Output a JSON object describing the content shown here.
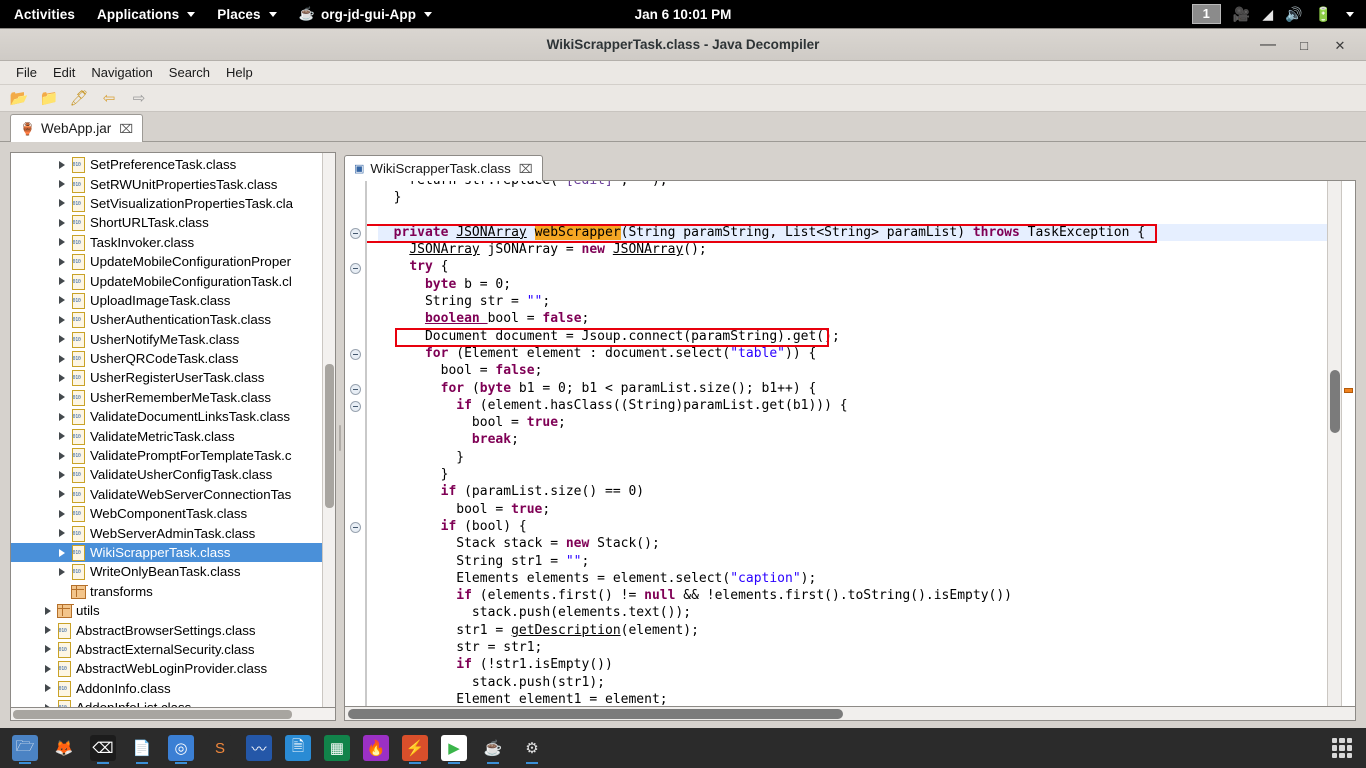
{
  "gnome_topbar": {
    "activities": "Activities",
    "applications": "Applications",
    "places": "Places",
    "app_menu": "org-jd-gui-App",
    "clock": "Jan 6  10:01 PM",
    "workspace": "1",
    "tray_icons": [
      "screencast-icon",
      "wifi-icon",
      "volume-icon",
      "battery-icon",
      "chevron-down-icon"
    ]
  },
  "window": {
    "title": "WikiScrapperTask.class - Java Decompiler",
    "minimize": "—",
    "maximize": "□",
    "close": "✕"
  },
  "menubar": {
    "items": [
      {
        "label": "File"
      },
      {
        "label": "Edit"
      },
      {
        "label": "Navigation"
      },
      {
        "label": "Search"
      },
      {
        "label": "Help"
      }
    ]
  },
  "toolbar": {
    "buttons": [
      {
        "name": "open-file-icon",
        "glyph": "📂"
      },
      {
        "name": "open-type-icon",
        "glyph": "📁"
      },
      {
        "name": "open-type-hierarchy-icon",
        "glyph": "🖊"
      },
      {
        "name": "back-arrow-icon",
        "glyph": "⇦"
      },
      {
        "name": "forward-arrow-icon",
        "glyph": "⇨"
      }
    ]
  },
  "jar_tab": {
    "label": "WebApp.jar",
    "close": "⌧"
  },
  "editor_tab": {
    "label": "WikiScrapperTask.class",
    "close": "⌧"
  },
  "tree": {
    "items": [
      {
        "label": "SetPreferenceTask.class",
        "type": "class",
        "indent": 3,
        "arrow": true,
        "selected": false
      },
      {
        "label": "SetRWUnitPropertiesTask.class",
        "type": "class",
        "indent": 3,
        "arrow": true,
        "selected": false
      },
      {
        "label": "SetVisualizationPropertiesTask.cla",
        "type": "class",
        "indent": 3,
        "arrow": true,
        "selected": false
      },
      {
        "label": "ShortURLTask.class",
        "type": "class",
        "indent": 3,
        "arrow": true,
        "selected": false
      },
      {
        "label": "TaskInvoker.class",
        "type": "class",
        "indent": 3,
        "arrow": true,
        "selected": false
      },
      {
        "label": "UpdateMobileConfigurationProper",
        "type": "class",
        "indent": 3,
        "arrow": true,
        "selected": false
      },
      {
        "label": "UpdateMobileConfigurationTask.cl",
        "type": "class",
        "indent": 3,
        "arrow": true,
        "selected": false
      },
      {
        "label": "UploadImageTask.class",
        "type": "class",
        "indent": 3,
        "arrow": true,
        "selected": false
      },
      {
        "label": "UsherAuthenticationTask.class",
        "type": "class",
        "indent": 3,
        "arrow": true,
        "selected": false
      },
      {
        "label": "UsherNotifyMeTask.class",
        "type": "class",
        "indent": 3,
        "arrow": true,
        "selected": false
      },
      {
        "label": "UsherQRCodeTask.class",
        "type": "class",
        "indent": 3,
        "arrow": true,
        "selected": false
      },
      {
        "label": "UsherRegisterUserTask.class",
        "type": "class",
        "indent": 3,
        "arrow": true,
        "selected": false
      },
      {
        "label": "UsherRememberMeTask.class",
        "type": "class",
        "indent": 3,
        "arrow": true,
        "selected": false
      },
      {
        "label": "ValidateDocumentLinksTask.class",
        "type": "class",
        "indent": 3,
        "arrow": true,
        "selected": false
      },
      {
        "label": "ValidateMetricTask.class",
        "type": "class",
        "indent": 3,
        "arrow": true,
        "selected": false
      },
      {
        "label": "ValidatePromptForTemplateTask.c",
        "type": "class",
        "indent": 3,
        "arrow": true,
        "selected": false
      },
      {
        "label": "ValidateUsherConfigTask.class",
        "type": "class",
        "indent": 3,
        "arrow": true,
        "selected": false
      },
      {
        "label": "ValidateWebServerConnectionTas",
        "type": "class",
        "indent": 3,
        "arrow": true,
        "selected": false
      },
      {
        "label": "WebComponentTask.class",
        "type": "class",
        "indent": 3,
        "arrow": true,
        "selected": false
      },
      {
        "label": "WebServerAdminTask.class",
        "type": "class",
        "indent": 3,
        "arrow": true,
        "selected": false
      },
      {
        "label": "WikiScrapperTask.class",
        "type": "class",
        "indent": 3,
        "arrow": true,
        "selected": true
      },
      {
        "label": "WriteOnlyBeanTask.class",
        "type": "class",
        "indent": 3,
        "arrow": true,
        "selected": false
      },
      {
        "label": "transforms",
        "type": "package",
        "indent": 3,
        "arrow": false,
        "selected": false
      },
      {
        "label": "utils",
        "type": "package",
        "indent": 2,
        "arrow": true,
        "selected": false
      },
      {
        "label": "AbstractBrowserSettings.class",
        "type": "class",
        "indent": 2,
        "arrow": true,
        "selected": false
      },
      {
        "label": "AbstractExternalSecurity.class",
        "type": "class",
        "indent": 2,
        "arrow": true,
        "selected": false
      },
      {
        "label": "AbstractWebLoginProvider.class",
        "type": "class",
        "indent": 2,
        "arrow": true,
        "selected": false
      },
      {
        "label": "AddonInfo.class",
        "type": "class",
        "indent": 2,
        "arrow": true,
        "selected": false
      },
      {
        "label": "AddonInfoList.class",
        "type": "class",
        "indent": 2,
        "arrow": true,
        "selected": false
      }
    ]
  },
  "code": {
    "language": "java",
    "highlighted_identifier": "webScrapper",
    "lines": [
      {
        "indent": 2,
        "clipped_top": true,
        "tokens": [
          {
            "t": "return ",
            "c": ""
          },
          {
            "t": "str.replace(",
            "c": ""
          },
          {
            "t": "\"[edit]\"",
            "c": "annot"
          },
          {
            "t": ", ",
            "c": ""
          },
          {
            "t": "\"\"",
            "c": "annot"
          },
          {
            "t": ");",
            "c": ""
          }
        ]
      },
      {
        "indent": 1,
        "tokens": [
          {
            "t": "}",
            "c": ""
          }
        ]
      },
      {
        "indent": 0,
        "tokens": []
      },
      {
        "indent": 1,
        "fold": true,
        "highlight_row": true,
        "boxed": "method-signature",
        "tokens": [
          {
            "t": "private ",
            "c": "kw"
          },
          {
            "t": "JSONArray",
            "c": "ul"
          },
          {
            "t": " ",
            "c": ""
          },
          {
            "t": "webScrapper",
            "c": "hlword"
          },
          {
            "t": "(String paramString, List<String> paramList) ",
            "c": ""
          },
          {
            "t": "throws ",
            "c": "kw"
          },
          {
            "t": "TaskException {",
            "c": ""
          }
        ]
      },
      {
        "indent": 2,
        "tokens": [
          {
            "t": "JSONArray",
            "c": "ul"
          },
          {
            "t": " jSONArray = ",
            "c": ""
          },
          {
            "t": "new ",
            "c": "kw"
          },
          {
            "t": "JSONArray",
            "c": "ul"
          },
          {
            "t": "();",
            "c": ""
          }
        ]
      },
      {
        "indent": 2,
        "fold": true,
        "tokens": [
          {
            "t": "try ",
            "c": "kw"
          },
          {
            "t": "{",
            "c": ""
          }
        ]
      },
      {
        "indent": 3,
        "tokens": [
          {
            "t": "byte ",
            "c": "kw"
          },
          {
            "t": "b = 0;",
            "c": ""
          }
        ]
      },
      {
        "indent": 3,
        "tokens": [
          {
            "t": "String str = ",
            "c": ""
          },
          {
            "t": "\"\"",
            "c": "str"
          },
          {
            "t": ";",
            "c": ""
          }
        ]
      },
      {
        "indent": 3,
        "tokens": [
          {
            "t": "boolean ",
            "c": "kw ul"
          },
          {
            "t": "bool = ",
            "c": ""
          },
          {
            "t": "false",
            "c": "kw"
          },
          {
            "t": ";",
            "c": ""
          }
        ]
      },
      {
        "indent": 3,
        "boxed": "jsoup-connect",
        "tokens": [
          {
            "t": "Document document = Jsoup.connect(paramString).get();",
            "c": ""
          }
        ]
      },
      {
        "indent": 3,
        "fold": true,
        "tokens": [
          {
            "t": "for ",
            "c": "kw"
          },
          {
            "t": "(Element element : document.select(",
            "c": ""
          },
          {
            "t": "\"table\"",
            "c": "str"
          },
          {
            "t": ")) {",
            "c": ""
          }
        ]
      },
      {
        "indent": 4,
        "tokens": [
          {
            "t": "bool = ",
            "c": ""
          },
          {
            "t": "false",
            "c": "kw"
          },
          {
            "t": ";",
            "c": ""
          }
        ]
      },
      {
        "indent": 4,
        "fold": true,
        "tokens": [
          {
            "t": "for ",
            "c": "kw"
          },
          {
            "t": "(",
            "c": ""
          },
          {
            "t": "byte ",
            "c": "kw"
          },
          {
            "t": "b1 = 0; b1 < paramList.size(); b1++) {",
            "c": ""
          }
        ]
      },
      {
        "indent": 5,
        "fold": true,
        "tokens": [
          {
            "t": "if ",
            "c": "kw"
          },
          {
            "t": "(element.hasClass((String)paramList.get(b1))) {",
            "c": ""
          }
        ]
      },
      {
        "indent": 6,
        "tokens": [
          {
            "t": "bool = ",
            "c": ""
          },
          {
            "t": "true",
            "c": "kw"
          },
          {
            "t": ";",
            "c": ""
          }
        ]
      },
      {
        "indent": 6,
        "tokens": [
          {
            "t": "break",
            "c": "kw"
          },
          {
            "t": ";",
            "c": ""
          }
        ]
      },
      {
        "indent": 5,
        "tokens": [
          {
            "t": "}",
            "c": ""
          }
        ]
      },
      {
        "indent": 4,
        "tokens": [
          {
            "t": "}",
            "c": ""
          }
        ]
      },
      {
        "indent": 4,
        "tokens": [
          {
            "t": "if ",
            "c": "kw"
          },
          {
            "t": "(paramList.size() == 0)",
            "c": ""
          }
        ]
      },
      {
        "indent": 5,
        "tokens": [
          {
            "t": "bool = ",
            "c": ""
          },
          {
            "t": "true",
            "c": "kw"
          },
          {
            "t": ";",
            "c": ""
          }
        ]
      },
      {
        "indent": 4,
        "fold": true,
        "tokens": [
          {
            "t": "if ",
            "c": "kw"
          },
          {
            "t": "(bool) {",
            "c": ""
          }
        ]
      },
      {
        "indent": 5,
        "tokens": [
          {
            "t": "Stack stack = ",
            "c": ""
          },
          {
            "t": "new ",
            "c": "kw"
          },
          {
            "t": "Stack();",
            "c": ""
          }
        ]
      },
      {
        "indent": 5,
        "tokens": [
          {
            "t": "String str1 = ",
            "c": ""
          },
          {
            "t": "\"\"",
            "c": "str"
          },
          {
            "t": ";",
            "c": ""
          }
        ]
      },
      {
        "indent": 5,
        "tokens": [
          {
            "t": "Elements elements = element.select(",
            "c": ""
          },
          {
            "t": "\"caption\"",
            "c": "str"
          },
          {
            "t": ");",
            "c": ""
          }
        ]
      },
      {
        "indent": 5,
        "tokens": [
          {
            "t": "if ",
            "c": "kw"
          },
          {
            "t": "(elements.first() != ",
            "c": ""
          },
          {
            "t": "null ",
            "c": "kw"
          },
          {
            "t": "&& !elements.first().toString().isEmpty())",
            "c": ""
          }
        ]
      },
      {
        "indent": 6,
        "tokens": [
          {
            "t": "stack.push(elements.text());",
            "c": ""
          }
        ]
      },
      {
        "indent": 5,
        "tokens": [
          {
            "t": "str1 = ",
            "c": ""
          },
          {
            "t": "getDescription",
            "c": "ul"
          },
          {
            "t": "(element);",
            "c": ""
          }
        ]
      },
      {
        "indent": 5,
        "tokens": [
          {
            "t": "str = str1;",
            "c": ""
          }
        ]
      },
      {
        "indent": 5,
        "tokens": [
          {
            "t": "if ",
            "c": "kw"
          },
          {
            "t": "(!str1.isEmpty())",
            "c": ""
          }
        ]
      },
      {
        "indent": 6,
        "tokens": [
          {
            "t": "stack.push(str1);",
            "c": ""
          }
        ]
      },
      {
        "indent": 5,
        "clipped_bottom": true,
        "tokens": [
          {
            "t": "Element element1 = element;",
            "c": ""
          }
        ]
      }
    ]
  },
  "dock": {
    "items": [
      {
        "name": "files-icon",
        "glyph": "🗁",
        "bg": "#4b83c4",
        "fg": "#ffffff",
        "running": true
      },
      {
        "name": "firefox-icon",
        "glyph": "🦊",
        "bg": "transparent",
        "fg": "#e8521f",
        "running": false
      },
      {
        "name": "terminal-icon",
        "glyph": "⌫",
        "bg": "#1c1c1c",
        "fg": "#ffffff",
        "running": true
      },
      {
        "name": "text-editor-icon",
        "glyph": "📄",
        "bg": "transparent",
        "fg": "#e8e8e8",
        "running": true
      },
      {
        "name": "chromium-icon",
        "glyph": "◎",
        "bg": "#3b7fd4",
        "fg": "#ffffff",
        "running": true
      },
      {
        "name": "sublime-text-icon",
        "glyph": "S",
        "bg": "#2b2b2b",
        "fg": "#f0873c",
        "running": false
      },
      {
        "name": "system-monitor-icon",
        "glyph": "〰",
        "bg": "#2457a8",
        "fg": "#ffffff",
        "running": false
      },
      {
        "name": "libreoffice-writer-icon",
        "glyph": "🗎",
        "bg": "#2a8bd4",
        "fg": "#ffffff",
        "running": false
      },
      {
        "name": "libreoffice-calc-icon",
        "glyph": "▦",
        "bg": "#11834a",
        "fg": "#ffffff",
        "running": false
      },
      {
        "name": "gimp-icon",
        "glyph": "🔥",
        "bg": "#9b30c4",
        "fg": "#ff9a2e",
        "running": false
      },
      {
        "name": "pdf-reader-icon",
        "glyph": "⚡",
        "bg": "#d94f2b",
        "fg": "#ffffff",
        "running": true
      },
      {
        "name": "play-store-icon",
        "glyph": "▶",
        "bg": "#ffffff",
        "fg": "#3ab54a",
        "running": true
      },
      {
        "name": "java-coffee-icon",
        "glyph": "☕",
        "bg": "transparent",
        "fg": "#e8cfa0",
        "running": true
      },
      {
        "name": "settings-gear-icon",
        "glyph": "⚙",
        "bg": "transparent",
        "fg": "#e0e0e0",
        "running": true
      }
    ],
    "show_apps": "show-applications-icon"
  }
}
